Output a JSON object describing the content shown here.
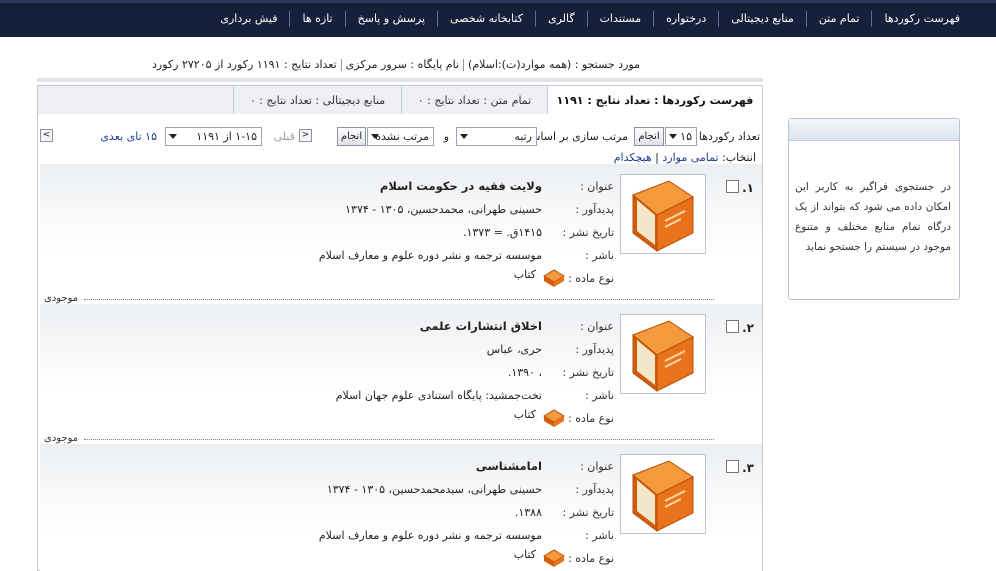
{
  "nav": {
    "items": [
      "فهرست رکوردها",
      "تمام متن",
      "منابع دیجیتالی",
      "درختواره",
      "مستندات",
      "گالری",
      "کتابخانه شخصی",
      "پرسش و پاسخ",
      "تازه ها",
      "فیش برداری"
    ]
  },
  "search_info": {
    "query": "مورد جستجو : (همه موارد(ت):اسلام)",
    "database": "نام پایگاه : سرور مرکزی",
    "count": "تعداد نتایج : ۱۱۹۱ رکورد از ۲۷۲۰۵ رکورد"
  },
  "tabs": {
    "catalog": "فهرست رکوردها : تعداد نتایج : ۱۱۹۱",
    "fulltext": "تمام متن : تعداد نتایج : ۰",
    "digital": "منابع دیجیتالی : تعداد نتایج : ۰"
  },
  "controls": {
    "records_label": "تعداد رکوردها",
    "records_value": "۱۵",
    "go_label": "انجام",
    "sort_label": "مرتب سازی بر اساس",
    "sort_value": "رتبه",
    "and_label": "و",
    "order_value": "مرتب نشده",
    "prev_label": "قبلی",
    "range_value": "۱-۱۵ از ۱۱۹۱",
    "next_label": "۱۵ تای بعدی",
    "prev_arrow": "<",
    "next_arrow": ">"
  },
  "selection": {
    "label": "انتخاب:",
    "all": "تمامی موارد",
    "separator": "|",
    "none": "هیچکدام"
  },
  "field_labels": {
    "title": "عنوان :",
    "author": "پدیدآور :",
    "date": "تاریخ نشر :",
    "publisher": "ناشر :",
    "type": "نوع ماده :"
  },
  "results": [
    {
      "num": "۱.",
      "title": "ولایت فقیه در حکومت اسلام",
      "author": "حسینی طهرانی، محمدحسین، ۱۳۰۵ - ۱۳۷۴",
      "date": "۱۴۱۵ق. = ۱۳۷۳.",
      "publisher": "موسسه ترجمه و نشر دوره علوم و معارف اسلام",
      "type": "کتاب",
      "availability": "موجودی"
    },
    {
      "num": "۲.",
      "title": "اخلاق انتشارات علمی",
      "author": "حری، عباس",
      "date": "، ۱۳۹۰.",
      "publisher": "تخت‌جمشید: پایگاه استنادی علوم جهان اسلام",
      "type": "کتاب",
      "availability": "موجودی"
    },
    {
      "num": "۳.",
      "title": "امامشناسی",
      "author": "حسینی طهرانی، سیدمحمدحسین، ۱۳۰۵ - ۱۳۷۴",
      "date": "۱۳۸۸.",
      "publisher": "موسسه ترجمه و نشر دوره علوم و معارف اسلام",
      "type": "کتاب",
      "availability": ""
    }
  ],
  "sidebox": {
    "text": "در جستجوی فراگیر به کاربر این امکان داده می شود که بتواند از یک درگاه تمام منابع مختلف و متنوع موجود در سیستم را جستجو نماید"
  },
  "colors": {
    "topbar": "#16203a",
    "link": "#1a3d8f",
    "book_orange": "#e8731a"
  }
}
